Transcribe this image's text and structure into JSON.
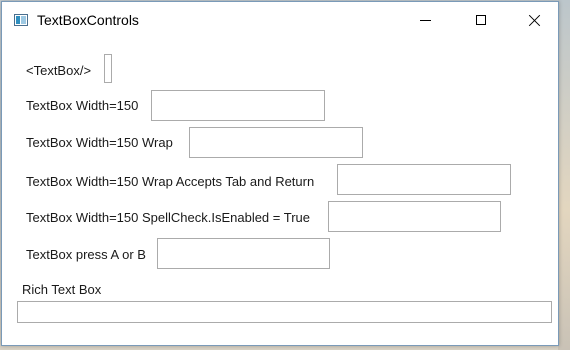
{
  "window": {
    "title": "TextBoxControls",
    "min_icon": "minimize-icon",
    "max_icon": "maximize-icon",
    "close_icon": "close-icon"
  },
  "rows": [
    {
      "label": "<TextBox/>",
      "value": ""
    },
    {
      "label": "TextBox Width=150",
      "value": ""
    },
    {
      "label": "TextBox Width=150 Wrap",
      "value": ""
    },
    {
      "label": "TextBox Width=150 Wrap Accepts Tab and Return",
      "value": ""
    },
    {
      "label": "TextBox Width=150 SpellCheck.IsEnabled = True",
      "value": ""
    },
    {
      "label": "TextBox press A or B",
      "value": ""
    }
  ],
  "rich_text_box": {
    "label": "Rich Text Box",
    "value": ""
  },
  "colors": {
    "window_border": "#7a9ab8",
    "textbox_border": "#ababab",
    "text": "#1a1a1a"
  }
}
